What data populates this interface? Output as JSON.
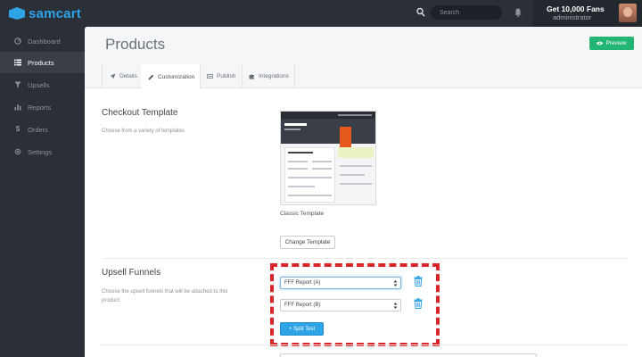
{
  "app": {
    "logo_text": "samcart"
  },
  "search": {
    "placeholder": "Search"
  },
  "user": {
    "name": "Get 10,000 Fans",
    "role": "administrator"
  },
  "sidebar": {
    "items": [
      {
        "label": "Dashboard",
        "icon": "dashboard-icon",
        "active": false
      },
      {
        "label": "Products",
        "icon": "list-icon",
        "active": true
      },
      {
        "label": "Upsells",
        "icon": "funnel-icon",
        "active": false
      },
      {
        "label": "Reports",
        "icon": "bar-chart-icon",
        "active": false
      },
      {
        "label": "Orders",
        "icon": "dollar-icon",
        "active": false
      },
      {
        "label": "Settings",
        "icon": "gear-icon",
        "active": false
      }
    ]
  },
  "header": {
    "title": "Products",
    "preview_label": "Preview"
  },
  "tabs": [
    {
      "label": "Details",
      "icon": "rocket-icon",
      "active": false
    },
    {
      "label": "Customization",
      "icon": "pencil-icon",
      "active": true
    },
    {
      "label": "Publish",
      "icon": "keyboard-icon",
      "active": false
    },
    {
      "label": "Integrations",
      "icon": "puzzle-icon",
      "active": false
    }
  ],
  "checkout": {
    "title": "Checkout Template",
    "description": "Choose from a variety of templates",
    "template_caption": "Classic Template",
    "change_button": "Change Template"
  },
  "upsell": {
    "title": "Upsell Funnels",
    "description": "Choose the upsell funnels that will be attached to this product",
    "funnels": [
      {
        "value": "FFF Report (A)"
      },
      {
        "value": "FFF Report (B)"
      }
    ],
    "split_test_button": "+ Split Test"
  },
  "colors": {
    "brand": "#2ea3e6",
    "preview_green": "#22b573",
    "highlight_red": "#d8262b",
    "sidebar_bg": "#2b3038"
  }
}
